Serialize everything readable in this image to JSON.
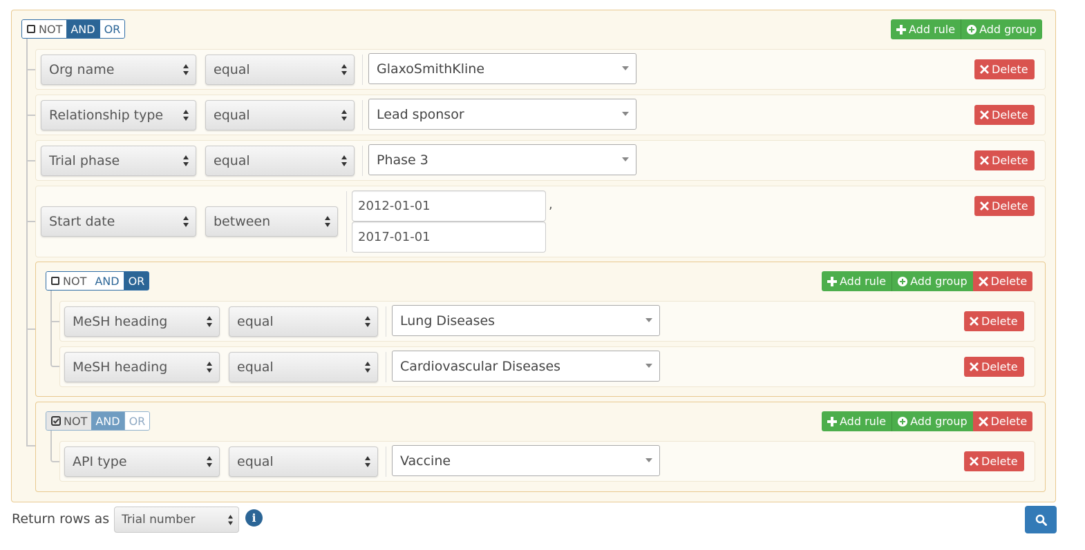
{
  "root_group": {
    "conditions": {
      "not": "NOT",
      "and": "AND",
      "or": "OR"
    },
    "add_rule": "Add rule",
    "add_group": "Add group",
    "rules": [
      {
        "field": "Org name",
        "operator": "equal",
        "value": "GlaxoSmithKline",
        "delete": "Delete"
      },
      {
        "field": "Relationship type",
        "operator": "equal",
        "value": "Lead sponsor",
        "delete": "Delete"
      },
      {
        "field": "Trial phase",
        "operator": "equal",
        "value": "Phase 3",
        "delete": "Delete"
      },
      {
        "field": "Start date",
        "operator": "between",
        "value_from": "2012-01-01",
        "value_sep": ",",
        "value_to": "2017-01-01",
        "delete": "Delete"
      }
    ]
  },
  "subgroup1": {
    "conditions": {
      "not": "NOT",
      "and": "AND",
      "or": "OR"
    },
    "not_checked": false,
    "active_condition": "OR",
    "add_rule": "Add rule",
    "add_group": "Add group",
    "delete": "Delete",
    "rules": [
      {
        "field": "MeSH heading",
        "operator": "equal",
        "value": "Lung Diseases",
        "delete": "Delete"
      },
      {
        "field": "MeSH heading",
        "operator": "equal",
        "value": "Cardiovascular Diseases",
        "delete": "Delete"
      }
    ]
  },
  "subgroup2": {
    "conditions": {
      "not": "NOT",
      "and": "AND",
      "or": "OR"
    },
    "not_checked": true,
    "active_condition": "AND",
    "add_rule": "Add rule",
    "add_group": "Add group",
    "delete": "Delete",
    "rules": [
      {
        "field": "API type",
        "operator": "equal",
        "value": "Vaccine",
        "delete": "Delete"
      }
    ]
  },
  "footer": {
    "return_label": "Return rows as",
    "return_value": "Trial number",
    "info_icon": "i"
  },
  "colors": {
    "primary": "#2b6596",
    "success": "#4cae4c",
    "danger": "#d9534f",
    "group_bg": "#fcf8ec",
    "group_border": "#e8c98f"
  },
  "icons": {
    "add_rule": "plus-icon",
    "add_group": "plus-circle-icon",
    "delete": "times-icon",
    "search": "search-icon",
    "info": "info-circle-icon"
  }
}
